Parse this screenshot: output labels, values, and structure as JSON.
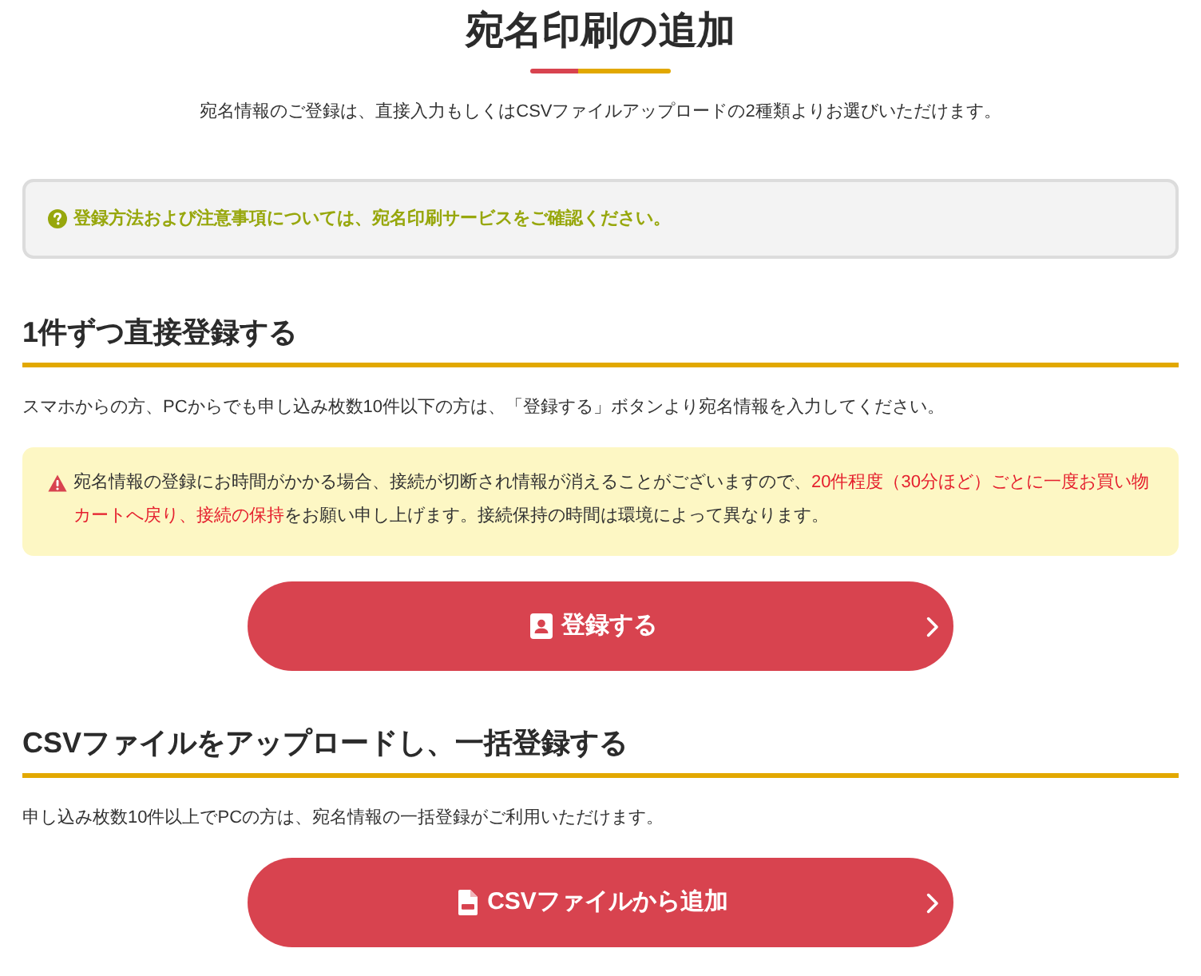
{
  "page": {
    "title": "宛名印刷の追加",
    "intro": "宛名情報のご登録は、直接入力もしくはCSVファイルアップロードの2種類よりお選びいただけます。"
  },
  "notice": {
    "text": "登録方法および注意事項については、宛名印刷サービスをご確認ください。"
  },
  "sections": [
    {
      "kind": "direct",
      "heading": "1件ずつ直接登録する",
      "description": "スマホからの方、PCからでも申し込み枚数10件以下の方は、「登録する」ボタンより宛名情報を入力してください。",
      "warning": {
        "segments": [
          {
            "text": "宛名情報の登録にお時間がかかる場合、接続が切断され情報が消えることがございますので、",
            "emphasis": false
          },
          {
            "text": "20件程度（30分ほど）ごとに一度お買い物カートへ戻り、接続の保持",
            "emphasis": true
          },
          {
            "text": "をお願い申し上げます。接続保持の時間は環境によって異なります。",
            "emphasis": false
          }
        ]
      },
      "button": {
        "label": "登録する"
      }
    },
    {
      "kind": "csv",
      "heading": "CSVファイルをアップロードし、一括登録する",
      "description": "申し込み枚数10件以上でPCの方は、宛名情報の一括登録がご利用いただけます。",
      "button": {
        "label": "CSVファイルから追加"
      }
    }
  ]
}
